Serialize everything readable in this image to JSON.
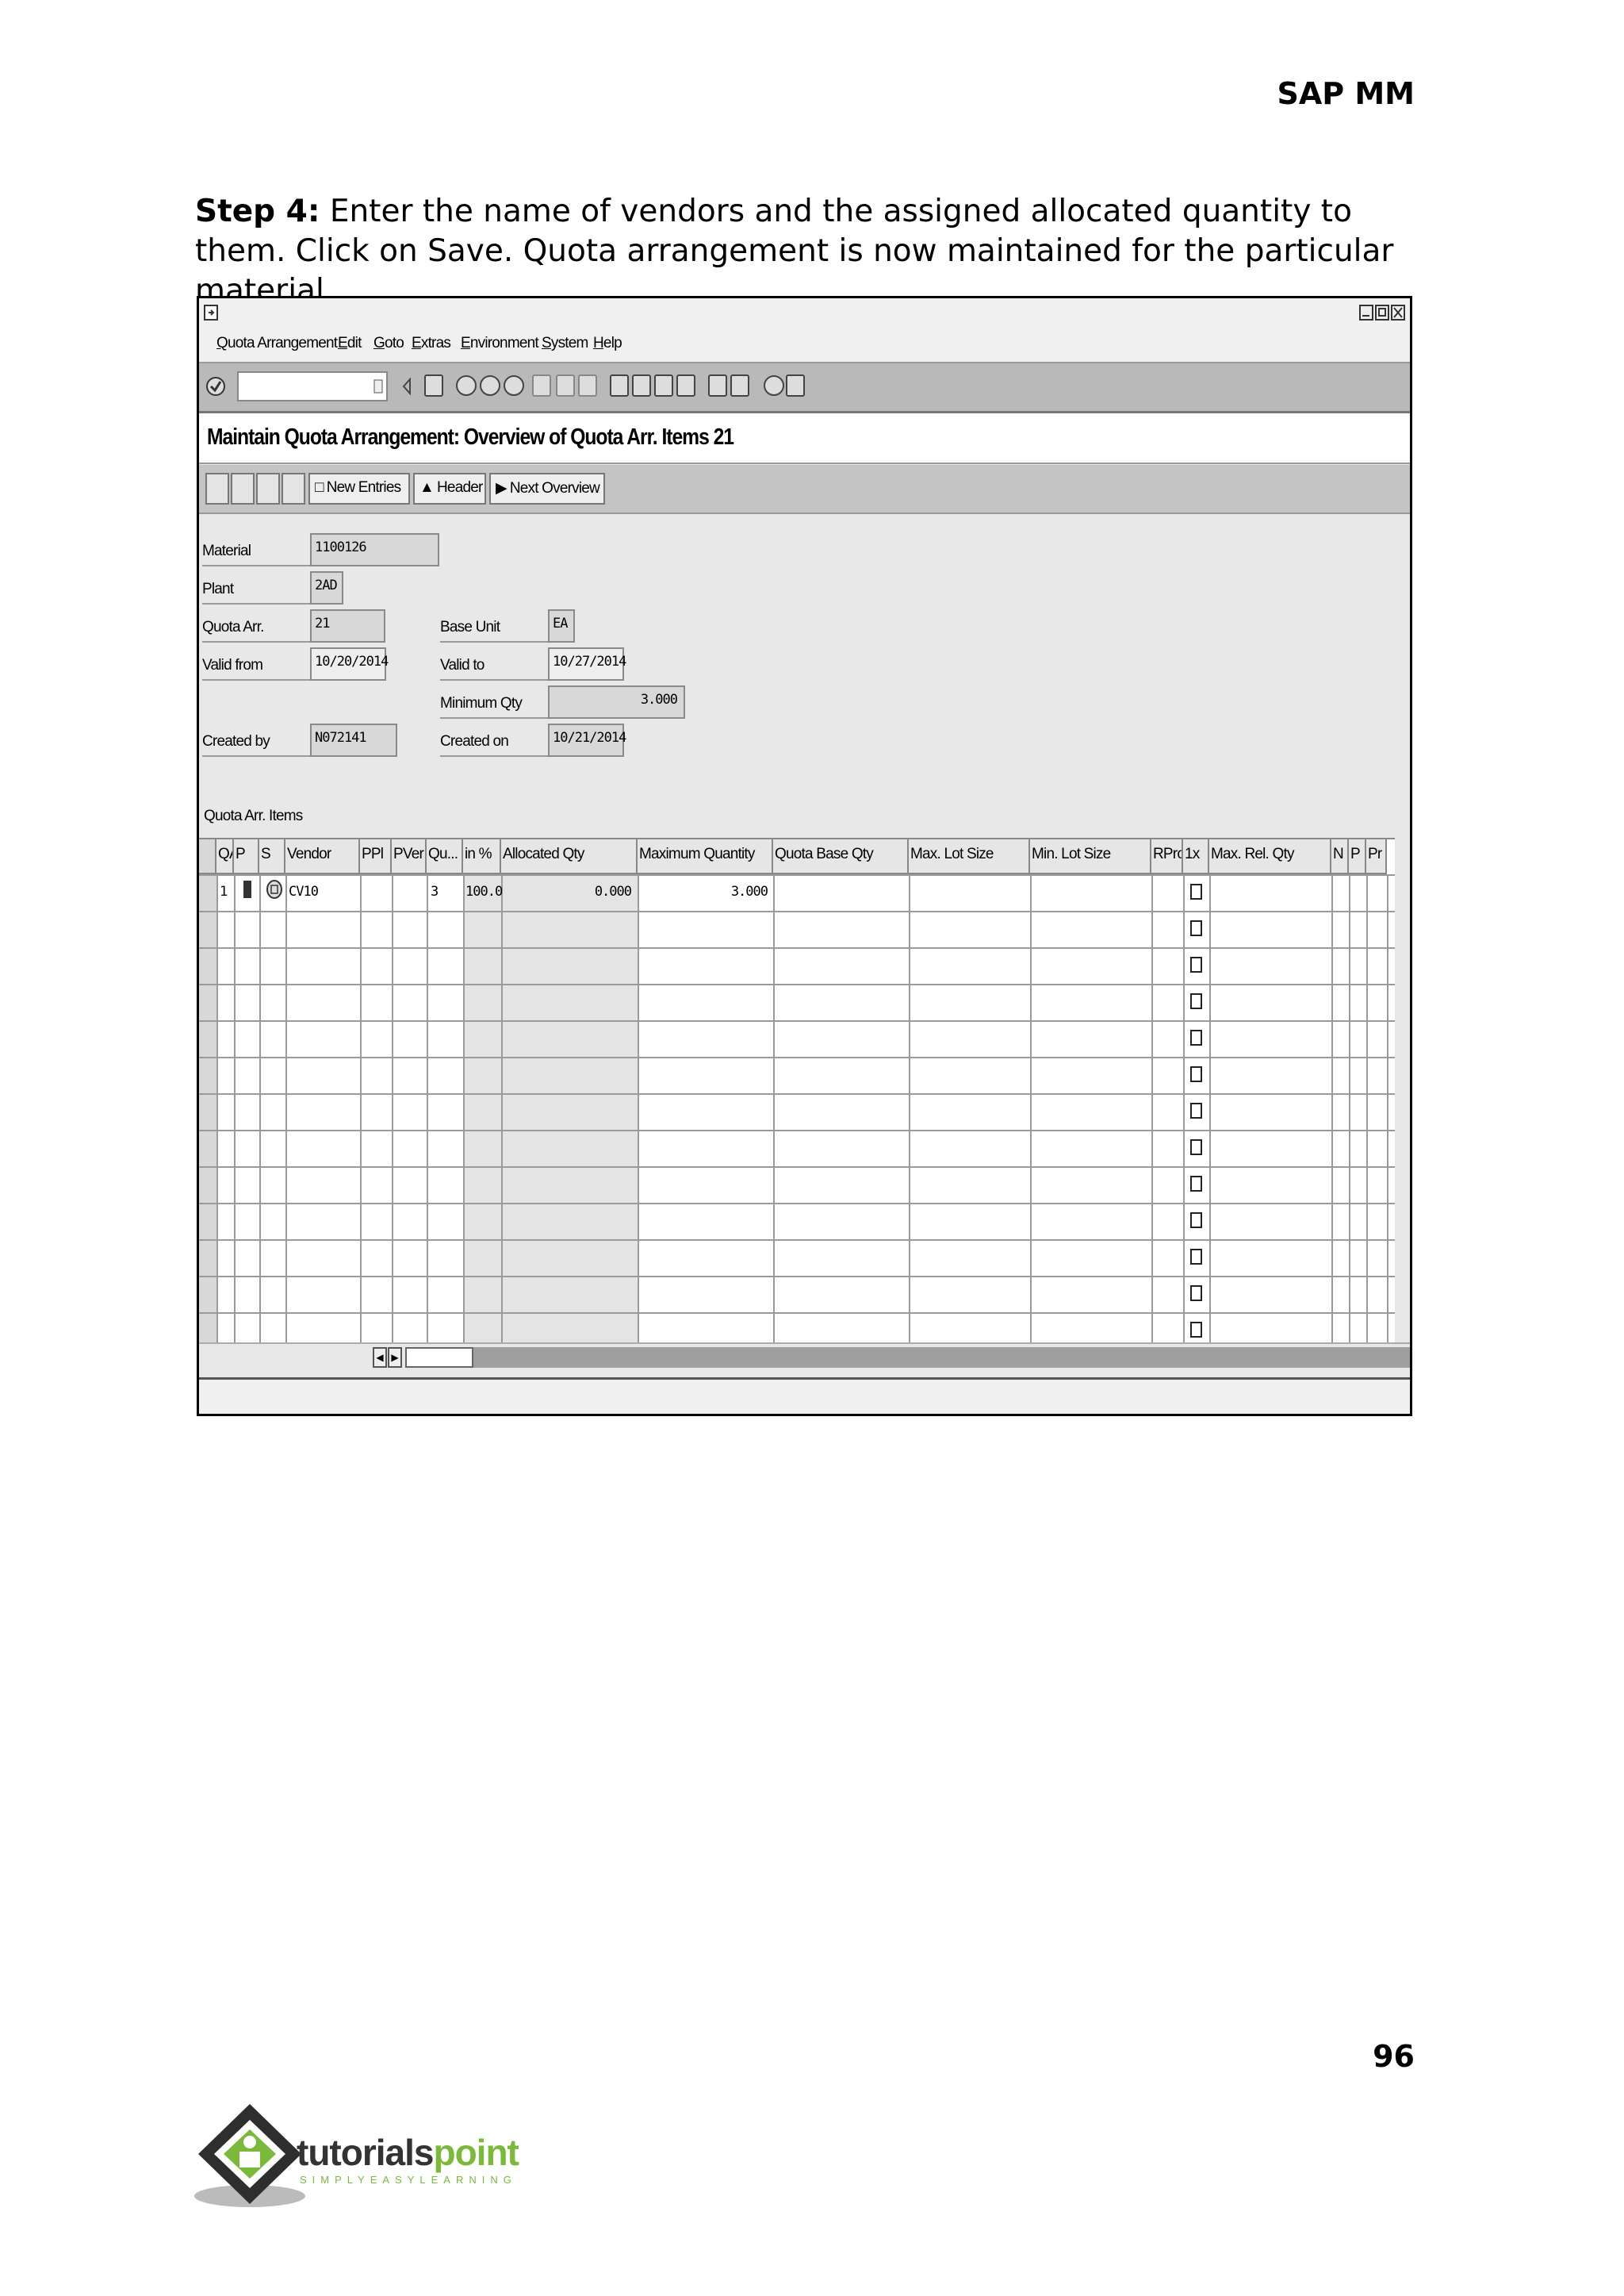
{
  "document": {
    "header": "SAP MM",
    "step_label": "Step 4:",
    "step_text": " Enter the name of vendors and the assigned allocated quantity to them. Click on Save. Quota arrangement is now maintained for the particular material.",
    "page_number": "96"
  },
  "sap": {
    "menu": [
      "Quota Arrangement",
      "Edit",
      "Goto",
      "Extras",
      "Environment",
      "System",
      "Help"
    ],
    "title": "Maintain Quota Arrangement: Overview of Quota Arr. Items 21",
    "app_buttons": {
      "new_entries": "New Entries",
      "header": "Header",
      "next_overview": "Next Overview"
    },
    "fields": {
      "material_label": "Material",
      "material": "1100126",
      "plant_label": "Plant",
      "plant": "2AD",
      "quota_arr_label": "Quota Arr.",
      "quota_arr": "21",
      "base_unit_label": "Base Unit",
      "base_unit": "EA",
      "valid_from_label": "Valid from",
      "valid_from": "10/20/2014",
      "valid_to_label": "Valid to",
      "valid_to": "10/27/2014",
      "minimum_qty_label": "Minimum Qty",
      "minimum_qty": "3.000",
      "created_by_label": "Created by",
      "created_by": "N072141",
      "created_on_label": "Created on",
      "created_on": "10/21/2014"
    },
    "section_label": "Quota Arr. Items",
    "columns": [
      "QAI",
      "P",
      "S",
      "Vendor",
      "PPl",
      "PVer",
      "Qu...",
      "in %",
      "Allocated Qty",
      "Maximum Quantity",
      "Quota Base Qty",
      "Max. Lot Size",
      "Min. Lot Size",
      "RPro",
      "1x",
      "Max. Rel. Qty",
      "N",
      "P",
      "Pr"
    ],
    "row1": {
      "qai": "1",
      "vendor": "CV10",
      "quota": "3",
      "pct": "100.0",
      "allocated": "0.000",
      "maximum": "3.000"
    }
  },
  "logo": {
    "word_a": "tutorials",
    "word_b": "point",
    "tagline": "SIMPLYEASYLEARNING"
  }
}
